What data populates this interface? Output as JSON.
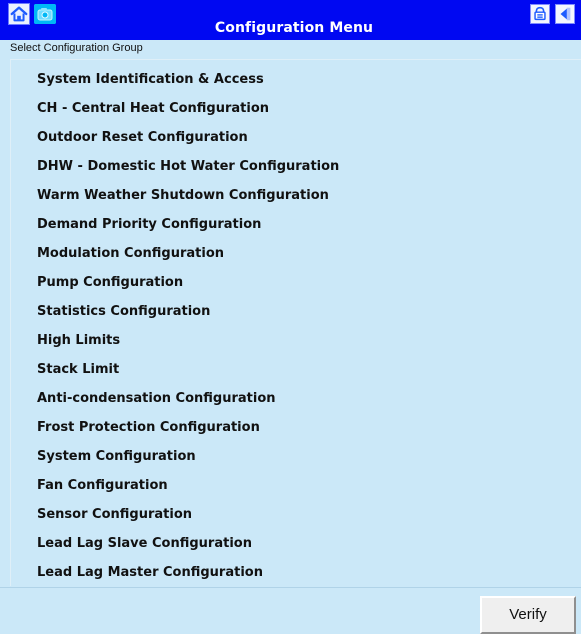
{
  "window": {
    "title": "Configuration Menu"
  },
  "toolbar": {
    "home_icon": "home-icon",
    "logo_icon": "camera-like-icon",
    "lock_icon": "lock-icon",
    "exit_icon": "exit-arrow-icon"
  },
  "menu": {
    "group_label": "Select Configuration Group",
    "items": [
      {
        "label": "System Identification & Access"
      },
      {
        "label": "CH - Central Heat Configuration"
      },
      {
        "label": "Outdoor Reset Configuration"
      },
      {
        "label": "DHW - Domestic Hot Water Configuration"
      },
      {
        "label": "Warm Weather Shutdown Configuration"
      },
      {
        "label": "Demand Priority Configuration"
      },
      {
        "label": "Modulation Configuration"
      },
      {
        "label": "Pump Configuration"
      },
      {
        "label": "Statistics Configuration"
      },
      {
        "label": "High Limits"
      },
      {
        "label": "Stack Limit"
      },
      {
        "label": "Anti-condensation Configuration"
      },
      {
        "label": "Frost Protection Configuration"
      },
      {
        "label": "System Configuration"
      },
      {
        "label": "Fan Configuration"
      },
      {
        "label": "Sensor Configuration"
      },
      {
        "label": "Lead Lag Slave Configuration"
      },
      {
        "label": "Lead Lag Master Configuration"
      }
    ]
  },
  "actions": {
    "verify_label": "Verify"
  },
  "colors": {
    "titlebar": "#0008f2",
    "panel": "#cbe8f8",
    "logo": "#00b8f6"
  }
}
